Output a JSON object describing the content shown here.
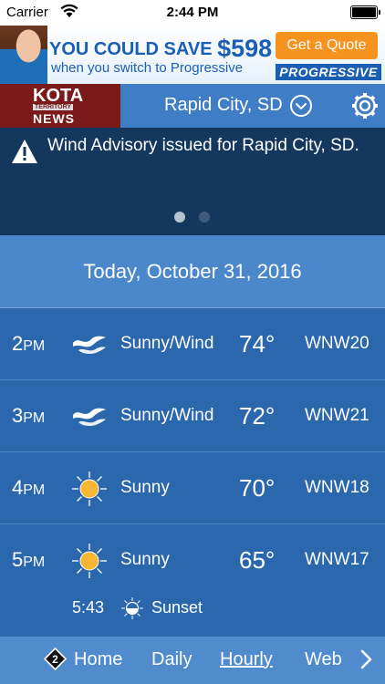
{
  "status_bar": {
    "carrier": "Carrier",
    "time": "2:44 PM",
    "wifi_icon": "wifi-icon",
    "battery_icon": "battery-icon"
  },
  "ad": {
    "headline_prefix": "YOU COULD SAVE",
    "amount": "$598",
    "subline": "when you switch to Progressive",
    "cta": "Get a Quote",
    "brand": "PROGRESSIVE",
    "colors": {
      "text": "#1a5fb4",
      "cta": "#f6921e"
    }
  },
  "header": {
    "logo": {
      "kota": "KOTA",
      "territory": "TERRITORY",
      "news": "NEWS"
    },
    "location": "Rapid City, SD",
    "chevron_icon": "chevron-down-circle-icon",
    "settings_icon": "gear-icon"
  },
  "alert": {
    "icon": "warning-icon",
    "message": "Wind Advisory issued for Rapid City, SD.",
    "pages": 2,
    "active_page": 1
  },
  "date_label": "Today, October 31, 2016",
  "hourly": [
    {
      "hour": "2",
      "ampm": "PM",
      "icon": "wind-icon",
      "condition": "Sunny/Wind",
      "temp": "74°",
      "wind": "WNW20"
    },
    {
      "hour": "3",
      "ampm": "PM",
      "icon": "wind-icon",
      "condition": "Sunny/Wind",
      "temp": "72°",
      "wind": "WNW21"
    },
    {
      "hour": "4",
      "ampm": "PM",
      "icon": "sun-icon",
      "condition": "Sunny",
      "temp": "70°",
      "wind": "WNW18"
    },
    {
      "hour": "5",
      "ampm": "PM",
      "icon": "sun-icon",
      "condition": "Sunny",
      "temp": "65°",
      "wind": "WNW17"
    }
  ],
  "sunset": {
    "time": "5:43",
    "label": "Sunset",
    "icon": "sunset-icon"
  },
  "nav": {
    "badge": "2",
    "items": [
      "Home",
      "Daily",
      "Hourly",
      "Web"
    ],
    "active": "Hourly",
    "next_icon": "chevron-right-icon"
  },
  "colors": {
    "background": "#2a67ad",
    "alert_bg": "#14375e",
    "header_bg": "#3f7ec6",
    "logo_bg": "#7a1a1a",
    "sun": "#f5b731"
  }
}
